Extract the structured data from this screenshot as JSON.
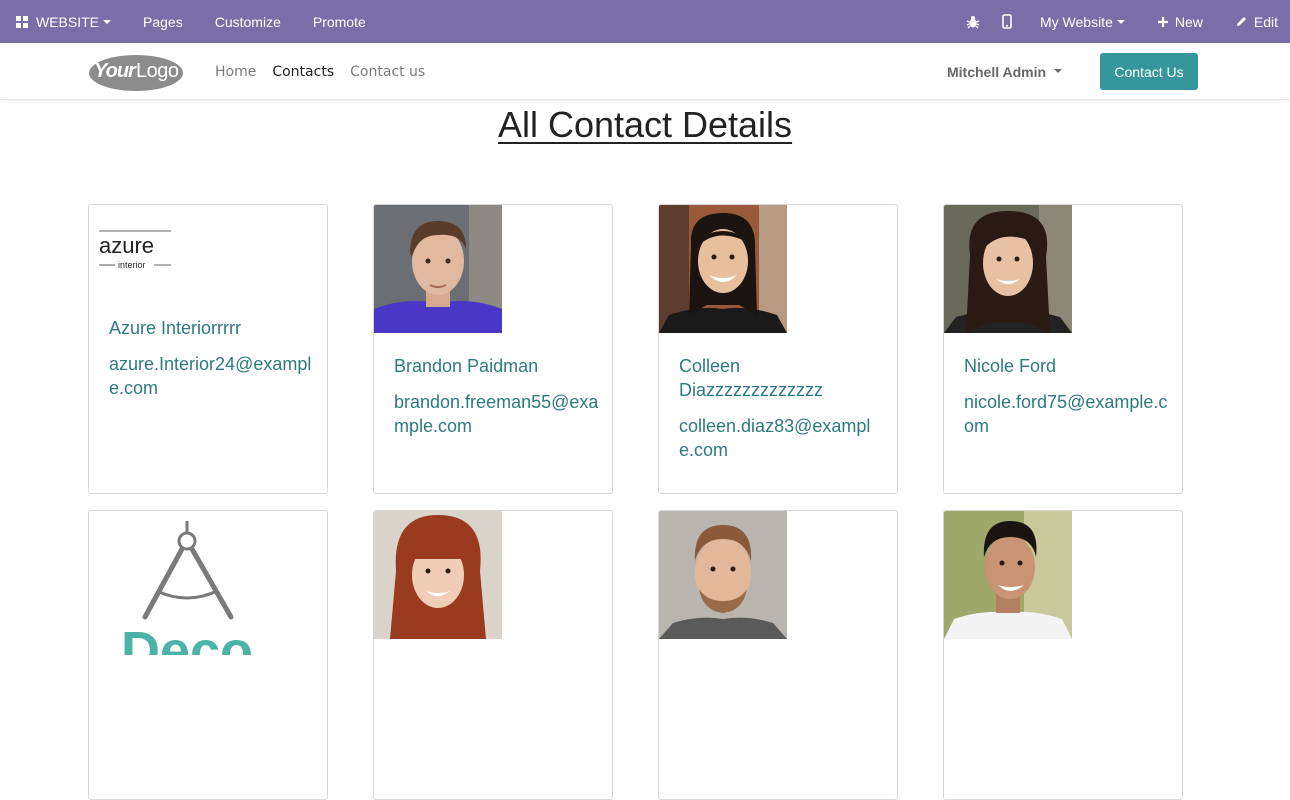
{
  "adminbar": {
    "website_label": "WEBSITE",
    "pages_label": "Pages",
    "customize_label": "Customize",
    "promote_label": "Promote",
    "my_website_label": "My Website",
    "new_label": "New",
    "edit_label": "Edit"
  },
  "header": {
    "logo_text": "YourLogo",
    "nav": [
      "Home",
      "Contacts",
      "Contact us"
    ],
    "active_nav": "Contacts",
    "user_name": "Mitchell Admin",
    "cta_label": "Contact Us"
  },
  "page": {
    "title": "All Contact Details"
  },
  "contacts": [
    {
      "name": "Azure Interiorrrrr",
      "email": "azure.Interior24@example.com",
      "logo_text": "azure",
      "logo_subtext": "interior"
    },
    {
      "name": "Brandon Paidman",
      "email": "brandon.freeman55@example.com"
    },
    {
      "name": "Colleen Diazzzzzzzzzzzzz",
      "email": "colleen.diaz83@example.com"
    },
    {
      "name": "Nicole Ford",
      "email": "nicole.ford75@example.com"
    },
    {
      "name": "",
      "email": "",
      "logo_text": "Deco"
    },
    {
      "name": "",
      "email": ""
    },
    {
      "name": "",
      "email": ""
    },
    {
      "name": "",
      "email": ""
    }
  ],
  "colors": {
    "adminbar": "#7a6ea8",
    "accent": "#35979c",
    "link": "#2e7a7f"
  }
}
